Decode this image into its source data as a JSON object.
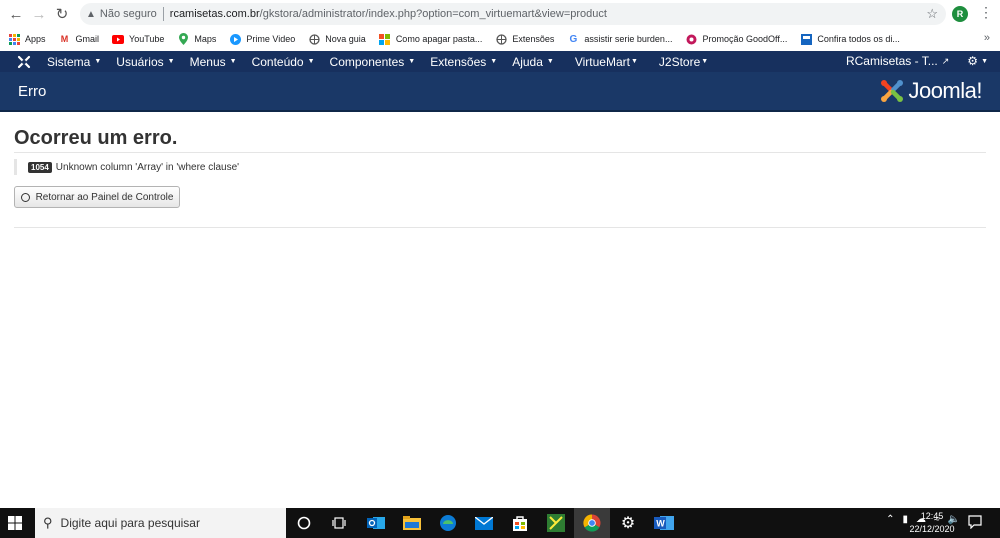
{
  "browser": {
    "security_label": "Não seguro",
    "url_host": "rcamisetas.com.br",
    "url_path": "/gkstora/administrator/index.php?option=com_virtuemart&view=product",
    "profile_initial": "R"
  },
  "bookmarks": [
    {
      "label": "Apps",
      "icon": "apps-grid-icon"
    },
    {
      "label": "Gmail",
      "icon": "gmail-icon"
    },
    {
      "label": "YouTube",
      "icon": "youtube-icon"
    },
    {
      "label": "Maps",
      "icon": "maps-icon"
    },
    {
      "label": "Prime Video",
      "icon": "prime-video-icon"
    },
    {
      "label": "Nova guia",
      "icon": "globe-icon"
    },
    {
      "label": "Como apagar pasta...",
      "icon": "windows-icon"
    },
    {
      "label": "Extensões",
      "icon": "globe-icon"
    },
    {
      "label": "assistir serie burden...",
      "icon": "google-icon"
    },
    {
      "label": "Promoção GoodOff...",
      "icon": "promo-icon"
    },
    {
      "label": "Confira todos os di...",
      "icon": "site-icon"
    }
  ],
  "joomla_nav": {
    "items": [
      "Sistema",
      "Usuários",
      "Menus",
      "Conteúdo",
      "Componentes",
      "Extensões",
      "Ajuda",
      "VirtueMart",
      "J2Store"
    ],
    "site_label": "RCamisetas - T..."
  },
  "header": {
    "title": "Erro",
    "brand": "Joomla!"
  },
  "error": {
    "heading": "Ocorreu um erro.",
    "code": "1054",
    "message": "Unknown column 'Array' in 'where clause'",
    "back_button": "Retornar ao Painel de Controle"
  },
  "taskbar": {
    "search_placeholder": "Digite aqui para pesquisar",
    "time": "12:45",
    "date": "22/12/2020"
  },
  "colors": {
    "navbar": "#17305e",
    "header": "#1a3867",
    "taskbar": "#101010"
  }
}
